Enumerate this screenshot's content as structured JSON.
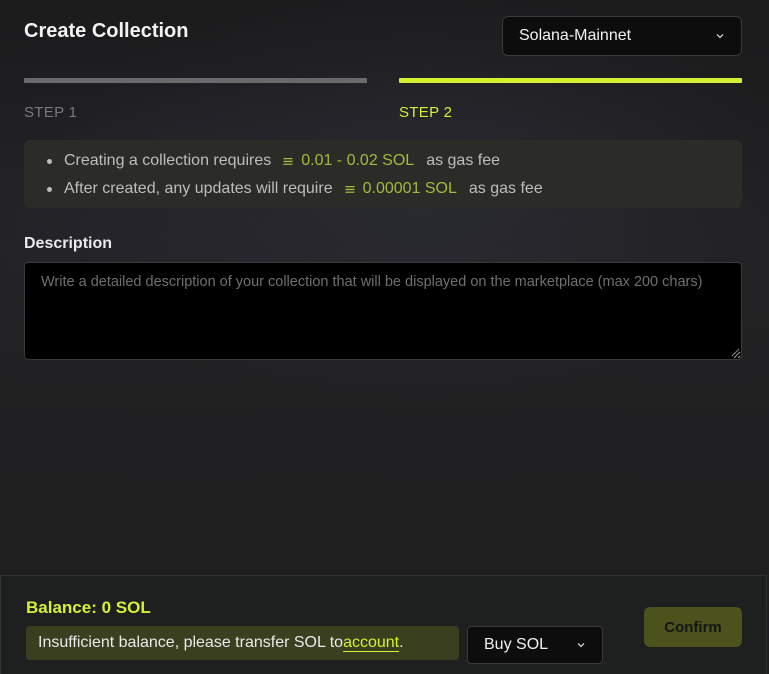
{
  "header": {
    "title": "Create Collection",
    "network": "Solana-Mainnet"
  },
  "steps": [
    {
      "label": "STEP 1",
      "active": false
    },
    {
      "label": "STEP 2",
      "active": true
    }
  ],
  "info": {
    "line1_prefix": "Creating a collection requires",
    "line1_amount": "0.01 - 0.02 SOL",
    "line1_suffix": "as gas fee",
    "line2_prefix": "After created, any updates will require",
    "line2_amount": "0.00001 SOL",
    "line2_suffix": "as gas fee"
  },
  "description": {
    "label": "Description",
    "placeholder": "Write a detailed description of your collection that will be displayed on the marketplace (max 200 chars)",
    "value": ""
  },
  "footer": {
    "balance": "Balance: 0 SOL",
    "warning_text": "Insufficient balance, please transfer SOL to",
    "warning_link": "account",
    "warning_end": ".",
    "buy_label": "Buy SOL",
    "confirm_label": "Confirm"
  },
  "colors": {
    "accent": "#d5f032",
    "sol_amount": "#a4b83d",
    "step_inactive": "#6a6a6a",
    "confirm_bg": "#4b521b"
  },
  "icons": [
    "chevron-down-icon",
    "sol-icon",
    "resize-grip-icon"
  ]
}
